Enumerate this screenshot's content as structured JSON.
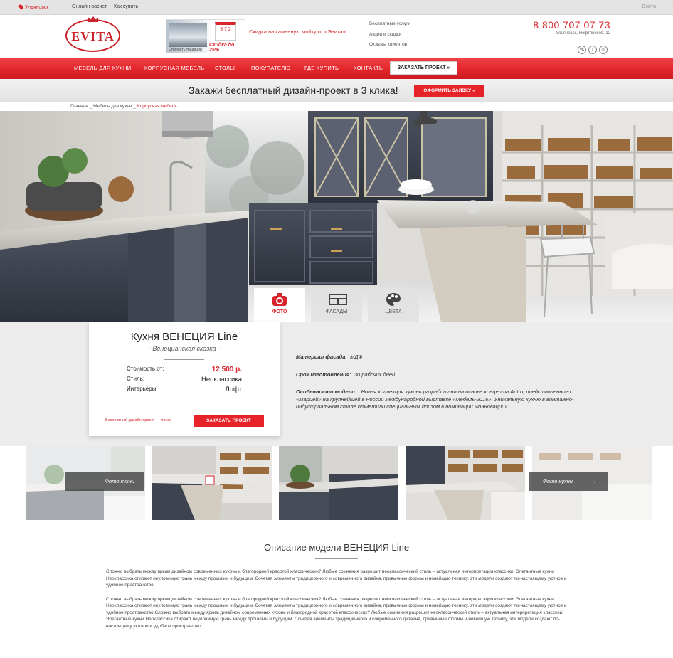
{
  "topbar": {
    "city": "Ульяновск",
    "links": [
      "Онлайн-расчет",
      "Как купить"
    ],
    "login": "Войти"
  },
  "header": {
    "logo_text": "EVITA",
    "promo": {
      "calendar_text": "3 7 2",
      "discount_text": "Скидка до 25%",
      "caption": "Строгость традиции",
      "text": "Скидка на каменную мойку от «Эвита»!"
    },
    "links": [
      "Бесплатные услуги",
      "Акции и скидки",
      "Отзывы клиентов"
    ],
    "phone": "8 800 707 07 73",
    "address": "Ульяновск, Нефтяников, 12",
    "social_icons": [
      "vk-icon",
      "facebook-icon",
      "instagram-icon"
    ]
  },
  "nav": {
    "items": [
      "МЕБЕЛЬ ДЛЯ КУХНИ",
      "КОРПУСНАЯ МЕБЕЛЬ",
      "СТОЛЫ",
      "ПОКУПАТЕЛЮ",
      "ГДЕ КУПИТЬ",
      "КОНТАКТЫ"
    ],
    "order_button": "ЗАКАЗАТЬ ПРОЕКТ »"
  },
  "banner": {
    "text": "Закажи бесплатный дизайн-проект в 3 клика!",
    "button": "ОФОРМИТЬ ЗАЯВКУ »"
  },
  "breadcrumb": {
    "items": [
      "Главная",
      "Мебель для кухни"
    ],
    "current": "Корпусная мебель",
    "separator": "_"
  },
  "hero": {
    "tabs": [
      {
        "label": "ФОТО",
        "icon": "camera-icon",
        "active": true
      },
      {
        "label": "ФАСАДЫ",
        "icon": "facade-icon",
        "active": false
      },
      {
        "label": "ЦВЕТА",
        "icon": "palette-icon",
        "active": false
      }
    ]
  },
  "product": {
    "title": "Кухня ВЕНЕЦИЯ Line",
    "subtitle": "- Венецианская сказка -",
    "rows": [
      {
        "label": "Стоимость от:",
        "value": "12 500 р."
      },
      {
        "label": "Стиль:",
        "value": "Неоклассика"
      },
      {
        "label": "Интерьеры:",
        "value": "Лофт"
      }
    ],
    "free_text": "Бесплатный дизайн-проект — легко!",
    "order_button": "ЗАКАЗАТЬ ПРОЕКТ"
  },
  "specs": [
    {
      "label": "Материал фасада:",
      "value": "МДФ"
    },
    {
      "label": "Срок изготовления:",
      "value": "30 рабочих дней"
    },
    {
      "label": "Особенности модели:",
      "value": "Новая коллекция кухонь разработана на основе концепта Antro, представленного «Марией» на крупнейшей в России международной выставке «Мебель-2016». Уникальную кухню в винтажно-индустриальном стиле отметили специальным призом в номинации «Инновации»."
    }
  ],
  "gallery": {
    "prev_label": "Фото кухни",
    "next_label": "Фото кухни",
    "arrow_left": "←",
    "arrow_right": "→"
  },
  "description": {
    "title": "Описание модели ВЕНЕЦИЯ Line",
    "paragraphs": [
      "Сложно выбрать между ярким дизайном современных кухонь и благородной красотой классических? Любые сомнения разрешит неоклассический стиль – актуальная интерпретация классики. Элегантные кухни Неоклассика стирают неуловимую грань между прошлым и будущим. Сочетая элементы традиционного и современного дизайна, привычные формы и новейшую технику, эти модели создают по-настоящему уютное и удобное пространство.",
      "Сложно выбрать между ярким дизайном современных кухонь и благородной красотой классических? Любые сомнения разрешит неоклассический стиль – актуальная интерпретация классики. Элегантные кухни Неоклассика стирают неуловимую грань между прошлым и будущим. Сочетая элементы традиционного и современного дизайна, привычные формы и новейшую технику, эти модели создают по-настоящему уютное и удобное пространство.Сложно выбрать между ярким дизайном современных кухонь и благородной красотой классических? Любые сомнения разрешит неоклассический стиль – актуальная интерпретация классики. Элегантные кухни Неоклассика стирают неуловимую грань между прошлым и будущим. Сочетая элементы традиционного и современного дизайна, привычные формы и новейшую технику, эти модели создают по-настоящему уютное и удобное пространство."
    ]
  },
  "colors": {
    "accent": "#e2262b",
    "cabinet": "#3a3f4b",
    "background_gray": "#ececec"
  }
}
